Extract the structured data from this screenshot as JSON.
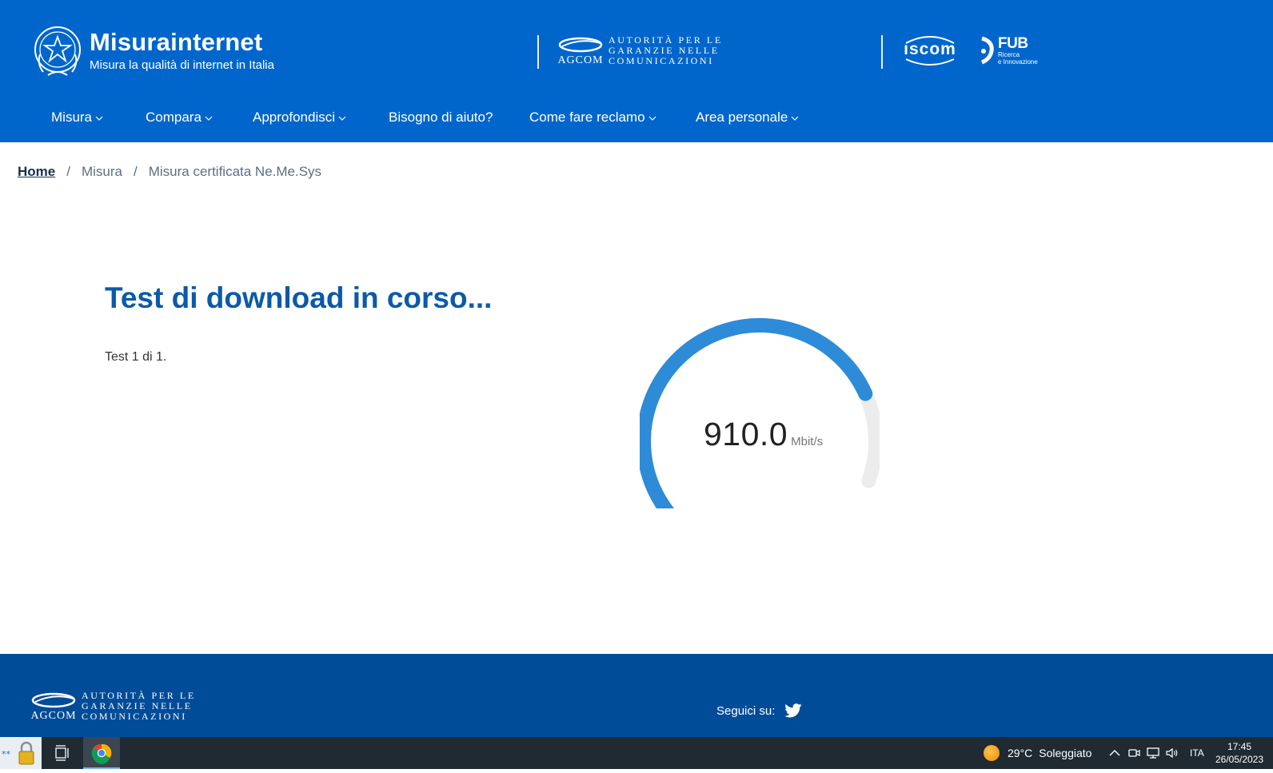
{
  "header": {
    "title": "Misurainternet",
    "subtitle": "Misura la qualità di internet in Italia",
    "agcom": {
      "word": "AGCOM",
      "lines": [
        "AUTORITÀ PER LE",
        "GARANZIE NELLE",
        "COMUNICAZIONI"
      ]
    },
    "partner_iscom": "ıscom",
    "partner_fub": {
      "title": "FUB",
      "line1": "Ricerca",
      "line2": "e Innovazione"
    },
    "brand_color": "#0066cc"
  },
  "nav": [
    {
      "label": "Misura",
      "dropdown": true
    },
    {
      "label": "Compara",
      "dropdown": true
    },
    {
      "label": "Approfondisci",
      "dropdown": true
    },
    {
      "label": "Bisogno di aiuto?",
      "dropdown": false
    },
    {
      "label": "Come fare reclamo",
      "dropdown": true
    },
    {
      "label": "Area personale",
      "dropdown": true
    }
  ],
  "breadcrumb": {
    "home": "Home",
    "separator": "/",
    "items": [
      "Misura",
      "Misura certificata Ne.Me.Sys"
    ]
  },
  "main": {
    "title": "Test di download in corso...",
    "test_count": "Test 1 di 1."
  },
  "gauge": {
    "value": "910.0",
    "unit": "Mbit/s",
    "fill_fraction": 0.83,
    "fill_color": "#2e8bd8",
    "track_color": "#ececec"
  },
  "footer": {
    "social_label": "Seguici su:",
    "social_icon": "twitter-icon",
    "background": "#004c99"
  },
  "taskbar": {
    "temperature": "29°C",
    "weather": "Soleggiato",
    "language": "ITA",
    "time": "17:45",
    "date": "26/05/2023"
  }
}
